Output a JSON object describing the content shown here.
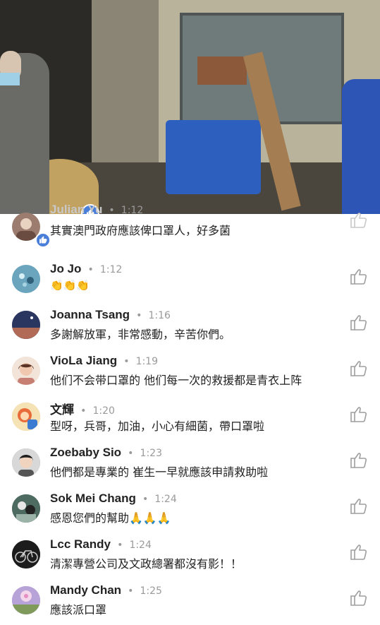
{
  "comments": [
    {
      "name": "Julian Yu",
      "time": "1:12",
      "text": "其實澳門政府應該俾口罩人，好多菌",
      "avatar_color": "#9b7c6e"
    },
    {
      "name": "Jo Jo",
      "time": "1:12",
      "text": "👏👏👏",
      "avatar_color": "#7fb3c7"
    },
    {
      "name": "Joanna Tsang",
      "time": "1:16",
      "text": "多謝解放軍，非常感動，辛苦你們。",
      "avatar_color": "#3b4870"
    },
    {
      "name": "VioLa Jiang",
      "time": "1:19",
      "text": "他们不会带口罩的 他们每一次的救援都是青衣上阵",
      "avatar_color": "#c88f77"
    },
    {
      "name": "文輝",
      "time": "1:20",
      "text": "型呀，兵哥，加油，小心有細菌，帶口罩啦",
      "avatar_color": "#e3a34a"
    },
    {
      "name": "Zoebaby Sio",
      "time": "1:23",
      "text": "他們都是專業的 崔生一早就應該申請救助啦",
      "avatar_color": "#8d8d8d"
    },
    {
      "name": "Sok Mei Chang",
      "time": "1:24",
      "text": "感恩您們的幫助🙏🙏🙏",
      "avatar_color": "#3a5a4d"
    },
    {
      "name": "Lcc Randy",
      "time": "1:24",
      "text": "清潔專營公司及文政總署都沒有影！！",
      "avatar_color": "#222222"
    },
    {
      "name": "Mandy Chan",
      "time": "1:25",
      "text": "應該派口罩",
      "avatar_color": "#9e83c2"
    }
  ],
  "separator": "•",
  "icons": {
    "like": "thumbs-up-icon",
    "reaction": "like-reaction-icon"
  },
  "colors": {
    "accent": "#4a7fd9",
    "meta": "#9a9a9a"
  }
}
